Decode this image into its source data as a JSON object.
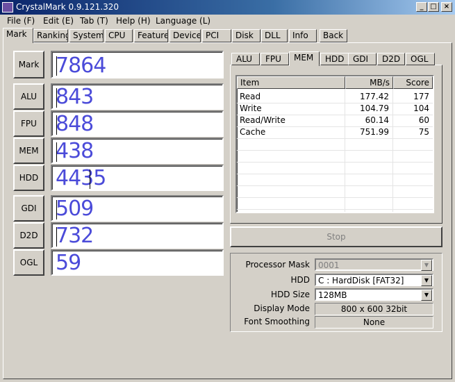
{
  "window": {
    "title": "CrystalMark 0.9.121.320",
    "min_glyph": "_",
    "max_glyph": "□",
    "close_glyph": "×"
  },
  "menu": [
    "File (F)",
    "Edit (E)",
    "Tab (T)",
    "Help (H)",
    "Language (L)"
  ],
  "tabs": [
    "Mark",
    "Ranking",
    "System",
    "CPU",
    "Feature",
    "Device",
    "PCI",
    "Disk",
    "DLL",
    "Info",
    "Back"
  ],
  "scores": [
    {
      "label": "Mark",
      "value": "7864"
    },
    {
      "label": "ALU",
      "value": "843"
    },
    {
      "label": "FPU",
      "value": "848"
    },
    {
      "label": "MEM",
      "value": "438"
    },
    {
      "label": "HDD",
      "value": "4435"
    },
    {
      "label": "GDI",
      "value": "509"
    },
    {
      "label": "D2D",
      "value": "732"
    },
    {
      "label": "OGL",
      "value": "59"
    }
  ],
  "subtabs": [
    "ALU",
    "FPU",
    "MEM",
    "HDD",
    "GDI",
    "D2D",
    "OGL"
  ],
  "table": {
    "headers": [
      "Item",
      "MB/s",
      "Score"
    ],
    "rows": [
      [
        "Read",
        "177.42",
        "177"
      ],
      [
        "Write",
        "104.79",
        "104"
      ],
      [
        "Read/Write",
        "60.14",
        "60"
      ],
      [
        "Cache",
        "751.99",
        "75"
      ]
    ]
  },
  "stop_label": "Stop",
  "settings": {
    "processor_mask_label": "Processor Mask",
    "processor_mask_value": "0001",
    "hdd_label": "HDD",
    "hdd_value": "C : HardDisk [FAT32]",
    "hdd_size_label": "HDD Size",
    "hdd_size_value": "128MB",
    "display_mode_label": "Display Mode",
    "display_mode_value": "800 x 600 32bit",
    "font_smoothing_label": "Font Smoothing",
    "font_smoothing_value": "None"
  },
  "colors": {
    "score_text": "#4b4bd9",
    "title_bar": "#0a246a"
  }
}
